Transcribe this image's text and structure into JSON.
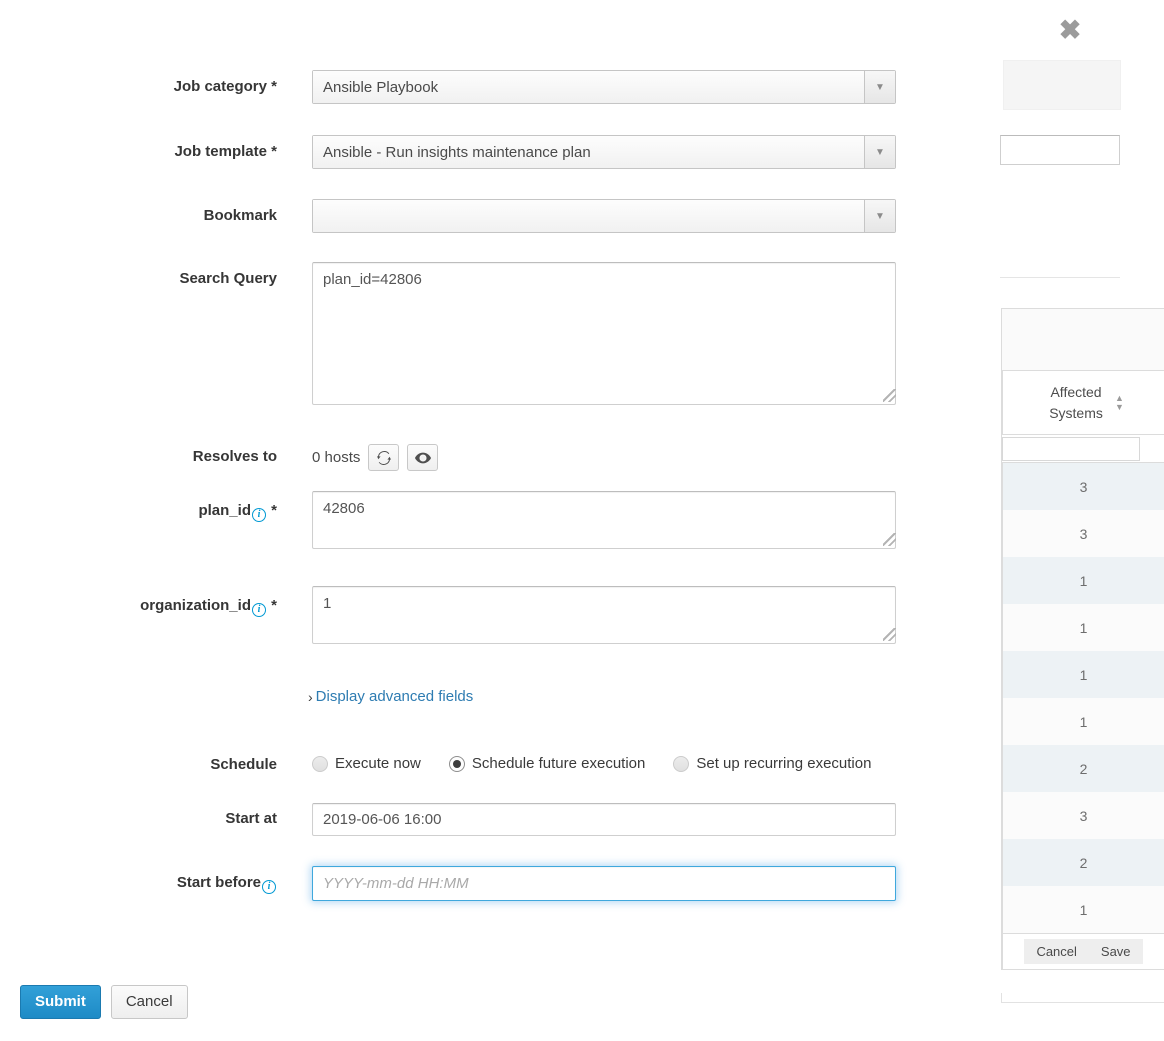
{
  "form": {
    "rows": [
      {
        "label": "Job category",
        "required": true,
        "value": "Ansible Playbook"
      },
      {
        "label": "Job template",
        "required": true,
        "value": "Ansible - Run insights maintenance plan"
      },
      {
        "label": "Bookmark",
        "required": false,
        "value": ""
      }
    ],
    "search_query": {
      "label": "Search Query",
      "value": "plan_id=42806"
    },
    "resolves_to": {
      "label": "Resolves to",
      "hosts_text": "0 hosts",
      "refresh_icon": "refresh-icon",
      "preview_icon": "eye-icon"
    },
    "plan_id": {
      "label": "plan_id",
      "required": true,
      "value": "42806",
      "info_icon": "info-icon"
    },
    "organization_id": {
      "label": "organization_id",
      "required": true,
      "value": "1",
      "info_icon": "info-icon"
    },
    "advanced_link": {
      "label": "Display advanced fields",
      "chevron": "›"
    },
    "schedule": {
      "label": "Schedule",
      "options": [
        {
          "label": "Execute now",
          "selected": false
        },
        {
          "label": "Schedule future execution",
          "selected": true
        },
        {
          "label": "Set up recurring execution",
          "selected": false
        }
      ]
    },
    "start_at": {
      "label": "Start at",
      "value": "2019-06-06 16:00"
    },
    "start_before": {
      "label": "Start before",
      "value": "",
      "placeholder": "YYYY-mm-dd HH:MM",
      "info_icon": "info-icon"
    },
    "actions": {
      "submit": "Submit",
      "cancel": "Cancel"
    },
    "required_marker": "*"
  },
  "background": {
    "close_icon": "close-icon",
    "close_glyph": "✖",
    "table": {
      "header": "Affected Systems",
      "sort_icon": "sort-icon",
      "rows": [
        "3",
        "3",
        "1",
        "1",
        "1",
        "1",
        "2",
        "3",
        "2",
        "1"
      ],
      "footer": {
        "cancel": "Cancel",
        "save": "Save"
      }
    }
  },
  "colors": {
    "accent": "#1e8bc6",
    "link": "#2e7cb2",
    "info": "#0099d3",
    "focus": "#3fa8dd",
    "row_alt": "#edf2f5"
  }
}
